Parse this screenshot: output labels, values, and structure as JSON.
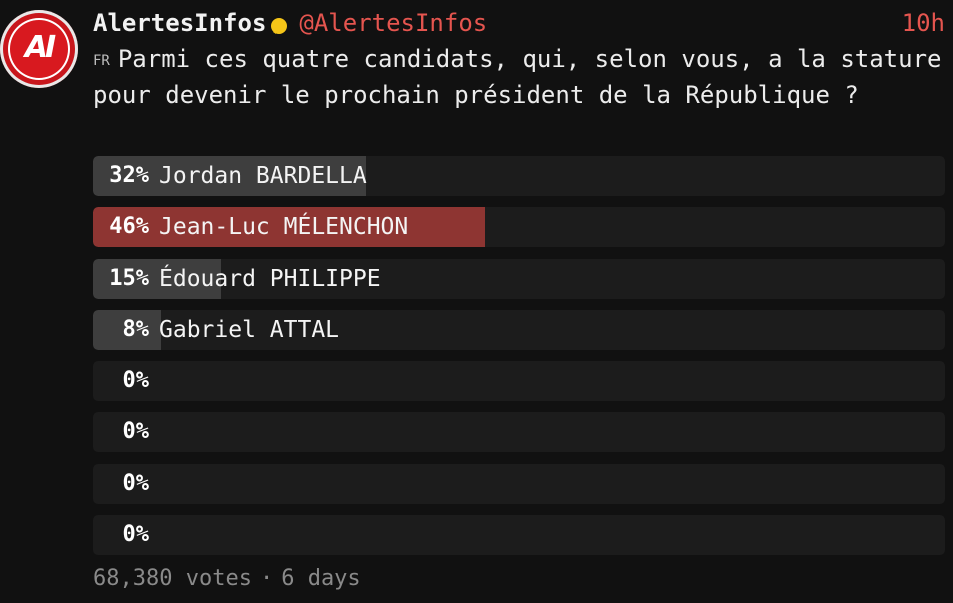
{
  "account": {
    "display_name": "AlertesInfos",
    "handle": "@AlertesInfos",
    "avatar_text": "AI",
    "verified_icon": "verified-badge-icon",
    "verified_color": "#f5c518"
  },
  "post": {
    "timestamp": "10h",
    "lang_tag": "FR",
    "question": "Parmi ces quatre candidats, qui, selon vous, a la stature pour devenir le prochain président de la République ?"
  },
  "poll": {
    "options": [
      {
        "percent_label": "32%",
        "percent": 32,
        "label": "Jordan BARDELLA",
        "winner": false
      },
      {
        "percent_label": "46%",
        "percent": 46,
        "label": "Jean-Luc MÉLENCHON",
        "winner": true
      },
      {
        "percent_label": "15%",
        "percent": 15,
        "label": "Édouard PHILIPPE",
        "winner": false
      },
      {
        "percent_label": "8%",
        "percent": 8,
        "label": "Gabriel ATTAL",
        "winner": false
      },
      {
        "percent_label": "0%",
        "percent": 0,
        "label": "",
        "winner": false
      },
      {
        "percent_label": "0%",
        "percent": 0,
        "label": "",
        "winner": false
      },
      {
        "percent_label": "0%",
        "percent": 0,
        "label": "",
        "winner": false
      },
      {
        "percent_label": "0%",
        "percent": 0,
        "label": "",
        "winner": false
      }
    ],
    "votes": "68,380 votes",
    "separator": "·",
    "duration": "6 days",
    "colors": {
      "winner_fill": "#8e3532",
      "fill": "#3e3e3e",
      "track": "#1c1c1c",
      "accent": "#e5554f"
    }
  }
}
